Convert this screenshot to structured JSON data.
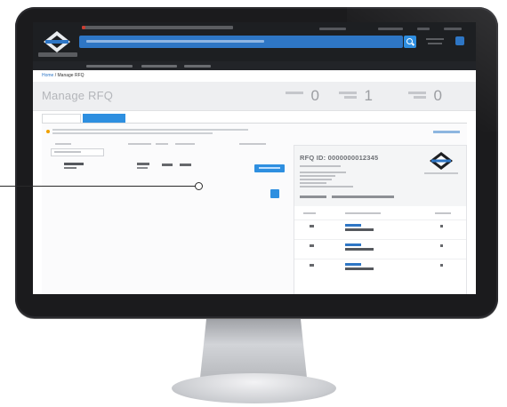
{
  "breadcrumb": {
    "home": "Home",
    "separator": "/",
    "current": "Manage RFQ"
  },
  "page": {
    "title": "Manage RFQ"
  },
  "stats": [
    {
      "value": "0"
    },
    {
      "value": "1"
    },
    {
      "value": "0"
    }
  ],
  "tabs": [
    {
      "state": "active"
    },
    {
      "state": "inactive"
    }
  ],
  "detail": {
    "rfq_id": "RFQ ID: 0000000012345"
  },
  "colors": {
    "bezel": "#1b1b1d",
    "topbar": "#1d1f22",
    "accent_blue": "#2e8fe0",
    "search_blue": "#2e76c5",
    "warning": "#f0a000"
  },
  "icons": {
    "search": "search-icon",
    "cart": "cart-icon",
    "brand": "brand-logo-icon",
    "warning": "warning-icon"
  }
}
